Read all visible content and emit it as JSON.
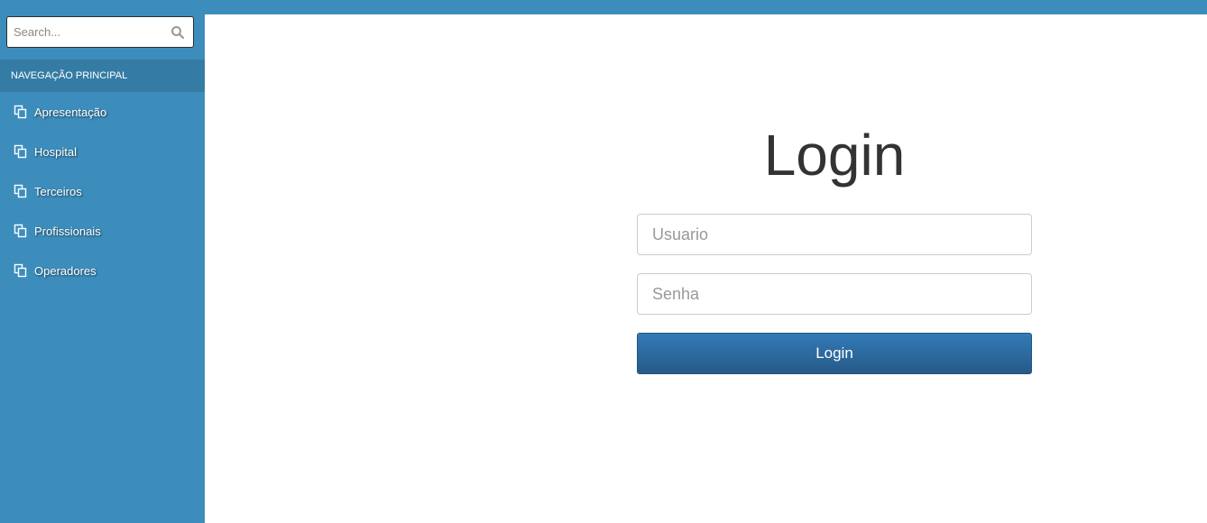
{
  "search": {
    "placeholder": "Search...",
    "icon": "search-icon"
  },
  "sidebar": {
    "header": "NAVEGAÇÃO PRINCIPAL",
    "items": [
      {
        "label": "Apresentação",
        "icon": "copy-icon"
      },
      {
        "label": "Hospital",
        "icon": "copy-icon"
      },
      {
        "label": "Terceiros",
        "icon": "copy-icon"
      },
      {
        "label": "Profissionais",
        "icon": "copy-icon"
      },
      {
        "label": "Operadores",
        "icon": "copy-icon"
      }
    ]
  },
  "login": {
    "title": "Login",
    "username_placeholder": "Usuario",
    "password_placeholder": "Senha",
    "button_label": "Login"
  },
  "colors": {
    "sidebar": "#3c8dbc",
    "sidebar_header": "#357ca5",
    "topbar": "#3c8dbc",
    "button": "#337ab7"
  }
}
